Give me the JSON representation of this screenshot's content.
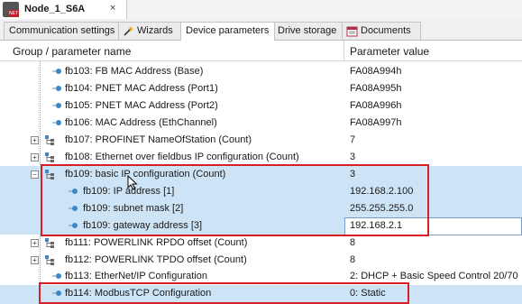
{
  "window": {
    "tab_title": "Node_1_S6A",
    "tab_close": "×",
    "node_icon_text": "NET"
  },
  "subtabs": [
    {
      "label": "Communication settings",
      "icon": ""
    },
    {
      "label": "Wizards",
      "icon": "wand-icon"
    },
    {
      "label": "Device parameters",
      "icon": ""
    },
    {
      "label": "Drive storage",
      "icon": ""
    },
    {
      "label": "Documents",
      "icon": "document-icon"
    }
  ],
  "header": {
    "col_name": "Group / parameter name",
    "col_value": "Parameter value"
  },
  "rows": [
    {
      "name": "fb103: FB MAC Address (Base)",
      "value": "FA08A994h",
      "icon": "parameter-icon"
    },
    {
      "name": "fb104: PNET MAC Address (Port1)",
      "value": "FA08A995h",
      "icon": "parameter-icon"
    },
    {
      "name": "fb105: PNET MAC Address (Port2)",
      "value": "FA08A996h",
      "icon": "parameter-icon"
    },
    {
      "name": "fb106: MAC Address (EthChannel)",
      "value": "FA08A997h",
      "icon": "parameter-icon"
    },
    {
      "name": "fb107: PROFINET NameOfStation (Count)",
      "value": "7",
      "icon": "group-icon",
      "expander": "+"
    },
    {
      "name": "fb108: Ethernet over fieldbus IP configuration (Count)",
      "value": "3",
      "icon": "group-icon",
      "expander": "+"
    },
    {
      "name": "fb109: basic IP configuration (Count)",
      "value": "3",
      "icon": "group-icon",
      "expander": "−"
    },
    {
      "name": "fb109: IP address [1]",
      "value": "192.168.2.100",
      "icon": "parameter-icon"
    },
    {
      "name": "fb109: subnet mask [2]",
      "value": "255.255.255.0",
      "icon": "parameter-icon"
    },
    {
      "name": "fb109: gateway address [3]",
      "value": "192.168.2.1",
      "icon": "parameter-icon"
    },
    {
      "name": "fb111: POWERLINK RPDO offset (Count)",
      "value": "8",
      "icon": "group-icon",
      "expander": "+"
    },
    {
      "name": "fb112: POWERLINK TPDO offset (Count)",
      "value": "8",
      "icon": "group-icon",
      "expander": "+"
    },
    {
      "name": "fb113: EtherNet/IP Configuration",
      "value": "2: DHCP + Basic Speed Control 20/70",
      "icon": "parameter-icon"
    },
    {
      "name": "fb114: ModbusTCP Configuration",
      "value": "0: Static",
      "icon": "parameter-icon"
    }
  ]
}
